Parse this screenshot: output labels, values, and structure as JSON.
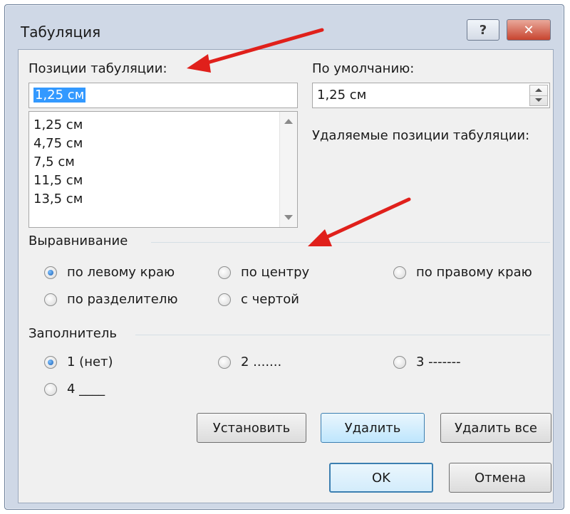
{
  "dialog": {
    "title": "Табуляция",
    "help_label": "?",
    "close_label": "✕"
  },
  "tab_positions": {
    "label": "Позиции табуляции:",
    "input_value": "1,25 см",
    "items": [
      "1,25 см",
      "4,75 см",
      "7,5 см",
      "11,5 см",
      "13,5 см"
    ]
  },
  "default_stops": {
    "label": "По умолчанию:",
    "value": "1,25 см"
  },
  "stops_to_clear": {
    "label": "Удаляемые позиции табуляции:"
  },
  "alignment": {
    "label": "Выравнивание",
    "options": [
      {
        "label": "по левому краю",
        "selected": true
      },
      {
        "label": "по центру",
        "selected": false
      },
      {
        "label": "по правому краю",
        "selected": false
      },
      {
        "label": "по разделителю",
        "selected": false
      },
      {
        "label": "с чертой",
        "selected": false
      }
    ]
  },
  "leader": {
    "label": "Заполнитель",
    "options": [
      {
        "label": "1 (нет)",
        "selected": true
      },
      {
        "label": "2 .......",
        "selected": false
      },
      {
        "label": "3 -------",
        "selected": false
      },
      {
        "label": "4 ____",
        "selected": false
      }
    ]
  },
  "buttons": {
    "set": "Установить",
    "clear": "Удалить",
    "clear_all": "Удалить все",
    "ok": "OK",
    "cancel": "Отмена"
  },
  "annotation_color": "#e0201b"
}
